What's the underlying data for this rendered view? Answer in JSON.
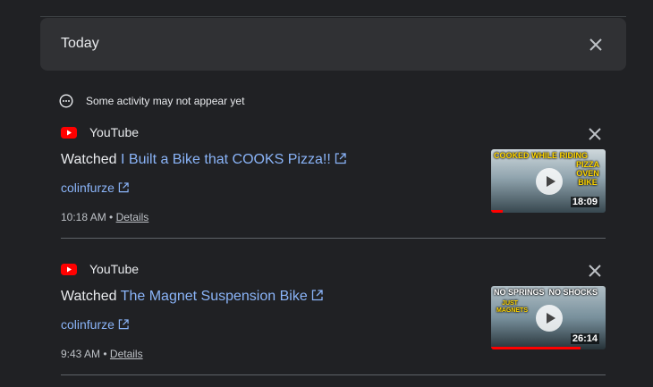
{
  "header": {
    "title": "Today",
    "close_icon": "close-icon"
  },
  "notice": {
    "text": "Some activity may not appear yet",
    "icon": "more-horizontal-circle-icon"
  },
  "items": [
    {
      "source": "YouTube",
      "verb": "Watched",
      "title": "I Built a Bike that COOKS Pizza!!",
      "channel": "colinfurze",
      "time": "10:18 AM",
      "separator": "•",
      "details": "Details",
      "duration": "18:09",
      "thumb_caption_top": "COOKED WHILE RIDING",
      "thumb_caption_right": "PIZZA OVEN BIKE",
      "watch_progress": 0.1
    },
    {
      "source": "YouTube",
      "verb": "Watched",
      "title": "The Magnet Suspension Bike",
      "channel": "colinfurze",
      "time": "9:43 AM",
      "separator": "•",
      "details": "Details",
      "duration": "26:14",
      "thumb_caption_top": "NO SPRINGS  NO SHOCKS",
      "thumb_caption_right": "JUST MAGNETS",
      "watch_progress": 0.78
    }
  ],
  "colors": {
    "link": "#8ab4f8",
    "background": "#202124",
    "header_bg": "#303134",
    "youtube_red": "#ff0000"
  }
}
